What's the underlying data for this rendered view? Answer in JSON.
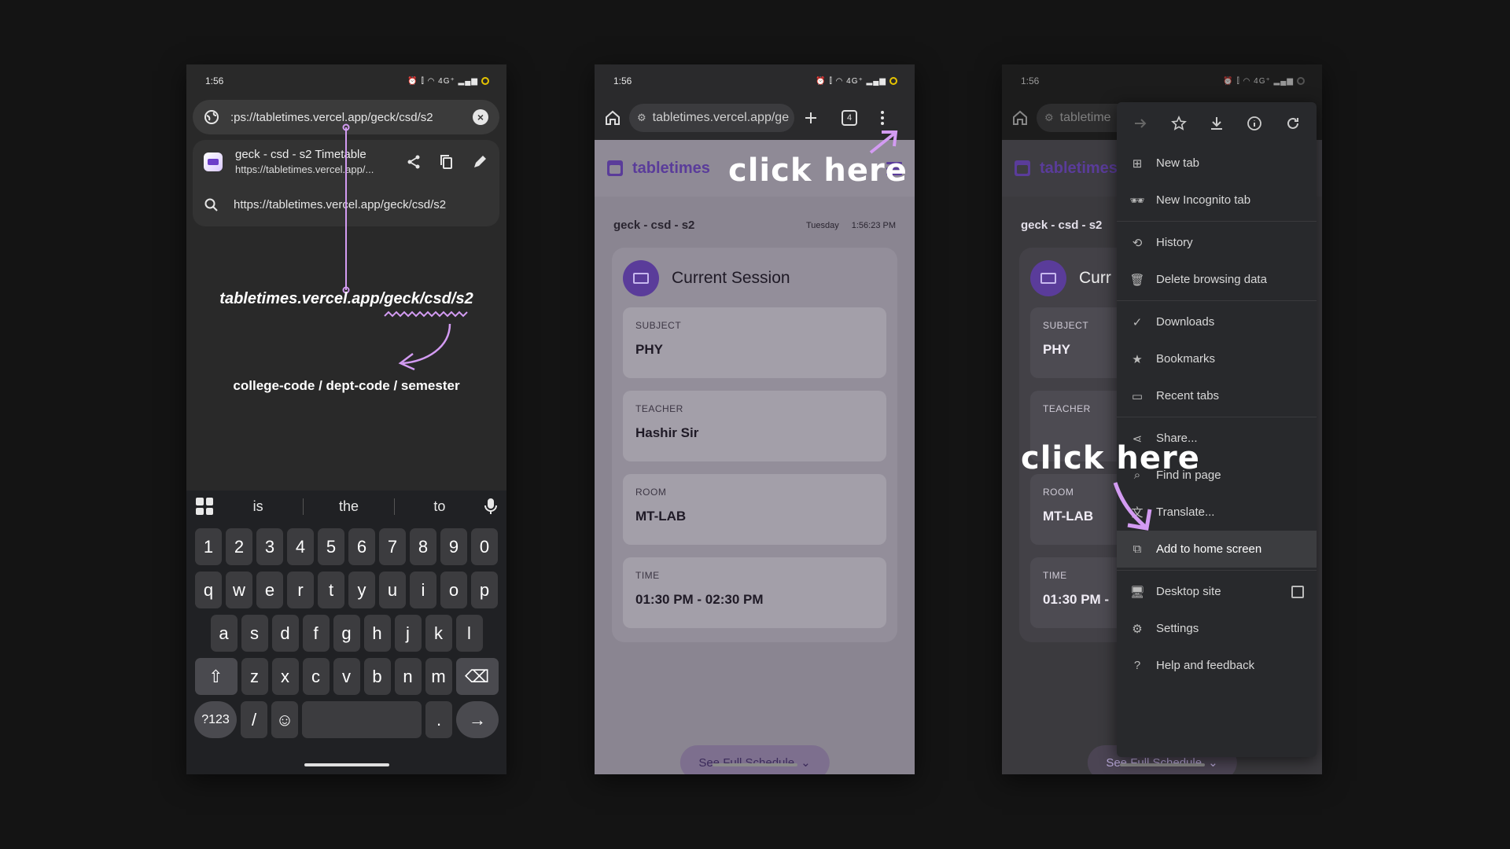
{
  "phone1": {
    "status": {
      "time": "1:56",
      "icons": "⏰ ⫿ ◠ 4G⁺ ▂▄▆"
    },
    "omnibox": {
      "value": ":ps://tabletimes.vercel.app/geck/csd/s2"
    },
    "suggestion": {
      "title": "geck - csd - s2 Timetable",
      "url": "https://tabletimes.vercel.app/..."
    },
    "search_suggestion": "https://tabletimes.vercel.app/geck/csd/s2",
    "annotation_url": "tabletimes.vercel.app/geck/csd/s2",
    "annotation_path": "college-code / dept-code / semester",
    "keyboard": {
      "suggestions": [
        "is",
        "the",
        "to"
      ],
      "numbers": [
        "1",
        "2",
        "3",
        "4",
        "5",
        "6",
        "7",
        "8",
        "9",
        "0"
      ],
      "row1": [
        "q",
        "w",
        "e",
        "r",
        "t",
        "y",
        "u",
        "i",
        "o",
        "p"
      ],
      "row2": [
        "a",
        "s",
        "d",
        "f",
        "g",
        "h",
        "j",
        "k",
        "l"
      ],
      "row3": [
        "z",
        "x",
        "c",
        "v",
        "b",
        "n",
        "m"
      ],
      "symbols_key": "?123",
      "slash_key": "/",
      "period_key": "."
    }
  },
  "phone2": {
    "status": {
      "time": "1:56",
      "icons": "⏰ ⫿ ◠ 4G⁺ ▂▄▆"
    },
    "url": "tabletimes.vercel.app/ge",
    "tab_count": "4",
    "click_label": "click here"
  },
  "phone3": {
    "status": {
      "time": "1:56",
      "icons": "⏰ ⫿ ◠ 4G⁺ ▂▄▆"
    },
    "url": "tabletime",
    "click_label": "click here",
    "menu": [
      {
        "label": "New tab",
        "icon": "plus-square-icon"
      },
      {
        "label": "New Incognito tab",
        "icon": "incognito-icon"
      },
      {
        "label": "History",
        "icon": "history-icon"
      },
      {
        "label": "Delete browsing data",
        "icon": "trash-icon"
      },
      {
        "label": "Downloads",
        "icon": "download-check-icon"
      },
      {
        "label": "Bookmarks",
        "icon": "star-icon"
      },
      {
        "label": "Recent tabs",
        "icon": "devices-icon"
      },
      {
        "label": "Share...",
        "icon": "share-icon"
      },
      {
        "label": "Find in page",
        "icon": "find-icon"
      },
      {
        "label": "Translate...",
        "icon": "translate-icon"
      },
      {
        "label": "Add to home screen",
        "icon": "add-home-icon"
      },
      {
        "label": "Desktop site",
        "icon": "desktop-icon"
      },
      {
        "label": "Settings",
        "icon": "gear-icon"
      },
      {
        "label": "Help and feedback",
        "icon": "help-icon"
      }
    ]
  },
  "site": {
    "brand": "tabletimes",
    "group": "geck - csd - s2",
    "day": "Tuesday",
    "clock": "1:56:23 PM",
    "card_title": "Current Session",
    "card_title_short": "Curr",
    "fields": [
      {
        "label": "SUBJECT",
        "value": "PHY"
      },
      {
        "label": "TEACHER",
        "value": "Hashir Sir"
      },
      {
        "label": "ROOM",
        "value": "MT-LAB"
      },
      {
        "label": "TIME",
        "value": "01:30 PM - 02:30 PM"
      }
    ],
    "time_short": "01:30 PM -",
    "schedule_button": "See Full Schedule"
  },
  "colors": {
    "accent": "#d39bf2",
    "brand": "#5a3c9a"
  }
}
